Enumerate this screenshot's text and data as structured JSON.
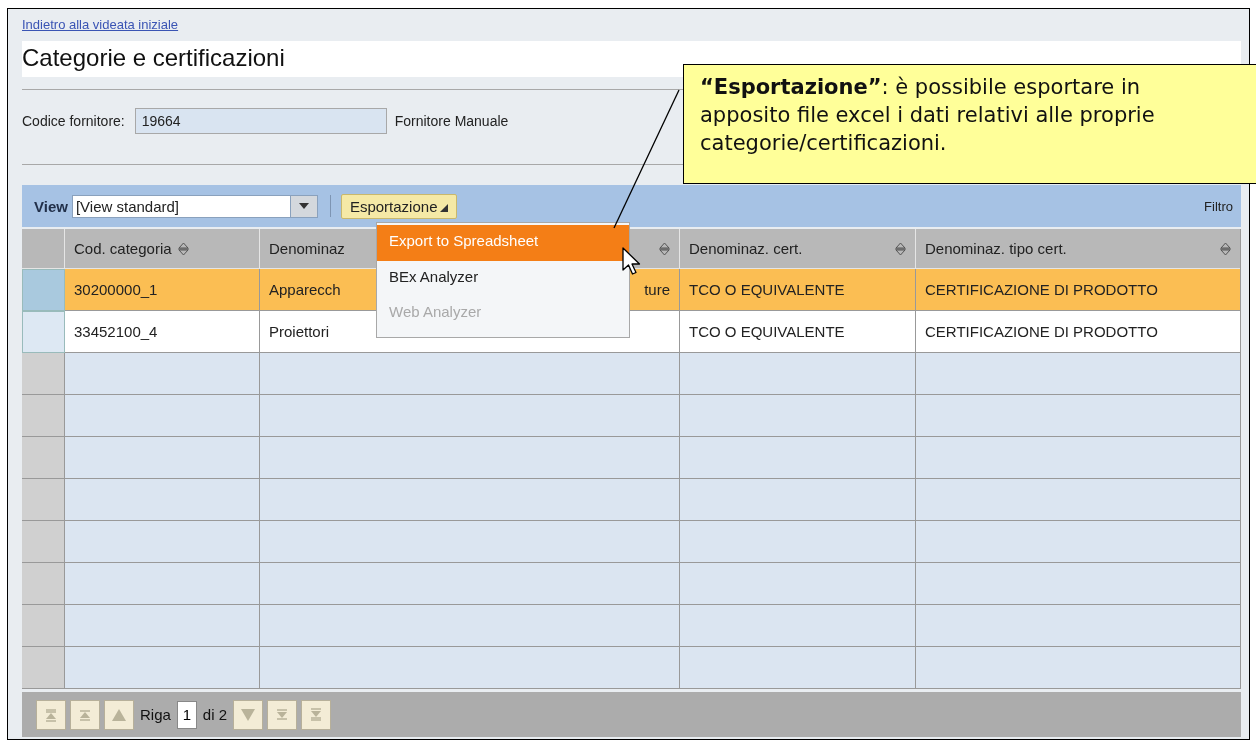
{
  "back_link": "Indietro alla videata iniziale",
  "title": "Categorie e certificazioni",
  "supplier": {
    "label": "Codice fornitore:",
    "value": "19664",
    "name": "Fornitore Manuale"
  },
  "toolbar": {
    "view_label": "View",
    "view_value": "[View standard]",
    "export_button": "Esportazione",
    "filter": "Filtro"
  },
  "export_menu": [
    {
      "label": "Export to Spreadsheet",
      "selected": true,
      "disabled": false
    },
    {
      "label": "BEx Analyzer",
      "selected": false,
      "disabled": false
    },
    {
      "label": "Web Analyzer",
      "selected": false,
      "disabled": true
    }
  ],
  "table": {
    "columns": [
      {
        "label": "Cod. categoria",
        "sortable": true
      },
      {
        "label": "Denominaz",
        "sortable": true
      },
      {
        "label": "Denominaz. cert.",
        "sortable": true
      },
      {
        "label": "Denominaz. tipo cert.",
        "sortable": true
      }
    ],
    "rows": [
      {
        "selected": true,
        "cells": [
          "30200000_1",
          [
            "Apparecch",
            "ture"
          ],
          "TCO O EQUIVALENTE",
          "CERTIFICAZIONE DI PRODOTTO"
        ]
      },
      {
        "selected": false,
        "cells": [
          "33452100_4",
          "Proiettori",
          "TCO O EQUIVALENTE",
          "CERTIFICAZIONE DI PRODOTTO"
        ]
      }
    ]
  },
  "pager": {
    "buttons_before": [
      {
        "kind": "first"
      },
      {
        "kind": "page-up"
      },
      {
        "kind": "up"
      }
    ],
    "label": "Riga",
    "value": "1",
    "total": "di 2",
    "buttons_after": [
      {
        "kind": "down"
      },
      {
        "kind": "page-down"
      },
      {
        "kind": "last"
      }
    ]
  },
  "callout": {
    "text": "**“Esportazione”**: è possibile esportare in apposito file excel i dati relativi alle proprie categorie/certificazioni."
  }
}
